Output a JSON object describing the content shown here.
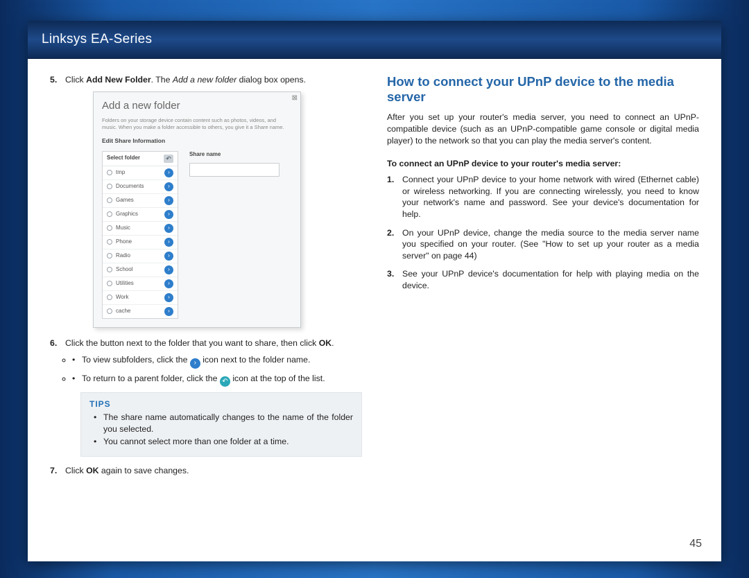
{
  "header": {
    "title": "Linksys EA-Series"
  },
  "left": {
    "step5_pre": "Click ",
    "step5_b": "Add New Folder",
    "step5_mid": ". The ",
    "step5_i": "Add a new folder",
    "step5_post": " dialog box opens.",
    "dialog": {
      "title": "Add a new folder",
      "desc": "Folders on your storage device contain content such as photos, videos, and music. When you make a folder accessible to others, you give it a Share name.",
      "section": "Edit Share Information",
      "select_folder": "Select folder",
      "share_name": "Share name",
      "folders": [
        "tmp",
        "Documents",
        "Games",
        "Graphics",
        "Music",
        "Phone",
        "Radio",
        "School",
        "Utilities",
        "Work",
        "cache"
      ]
    },
    "step6_pre": "Click the button next to the folder that you want to share, then click ",
    "step6_b": "OK",
    "step6_post": ".",
    "step6_sub1_pre": "To view subfolders, click the ",
    "step6_sub1_post": " icon next to the folder name.",
    "step6_sub2_pre": "To return to a parent folder, click the ",
    "step6_sub2_post": " icon at the top of the list.",
    "tips_title": "TIPS",
    "tips": [
      "The share name automatically changes to the name of the folder you selected.",
      "You cannot select more than one folder at a time."
    ],
    "step7_pre": "Click ",
    "step7_b": "OK",
    "step7_post": " again to save changes."
  },
  "right": {
    "title": "How to connect your UPnP device to the media server",
    "intro": "After you set up your router's media server, you need to connect an UPnP-compatible device (such as an UPnP-compatible game console or digital media player) to the network so that you can play the media server's content.",
    "subhead": "To connect an UPnP device to your router's media server:",
    "steps": [
      "Connect your UPnP device to your home network with wired (Ethernet cable) or wireless networking. If you are connecting wirelessly, you need to know your network's name and password. See your device's documentation for help.",
      "On your UPnP device, change the media source to the media server name you specified on your router. (See \"How to set up your router as a media server\" on page 44)",
      "See your UPnP device's documentation for help with playing media on the device."
    ]
  },
  "page_number": "45"
}
